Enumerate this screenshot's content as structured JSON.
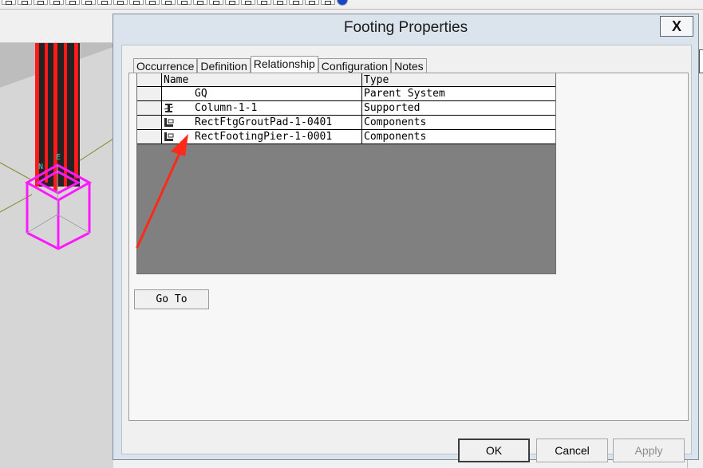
{
  "dialog": {
    "title": "Footing Properties",
    "close_label": "X",
    "tabs": [
      {
        "label": "Occurrence",
        "active": false
      },
      {
        "label": "Definition",
        "active": false
      },
      {
        "label": "Relationship",
        "active": true
      },
      {
        "label": "Configuration",
        "active": false
      },
      {
        "label": "Notes",
        "active": false
      }
    ],
    "grid": {
      "columns": [
        "Name",
        "Type"
      ],
      "rows": [
        {
          "name": "GQ",
          "type": "Parent System",
          "icon": "none"
        },
        {
          "name": "Column-1-1",
          "type": "Supported",
          "icon": "column-part-icon"
        },
        {
          "name": "RectFtgGroutPad-1-0401",
          "type": "Components",
          "icon": "component-part-icon"
        },
        {
          "name": "RectFootingPier-1-0001",
          "type": "Components",
          "icon": "component-part-icon"
        }
      ]
    },
    "goto_label": "Go To",
    "buttons": {
      "ok": "OK",
      "cancel": "Cancel",
      "apply": "Apply"
    }
  },
  "colors": {
    "grid_empty_area": "#808080",
    "annotation_arrow": "#ff2a1a",
    "footing_outline": "#ff19ff",
    "column_red": "#ff1a1a"
  }
}
